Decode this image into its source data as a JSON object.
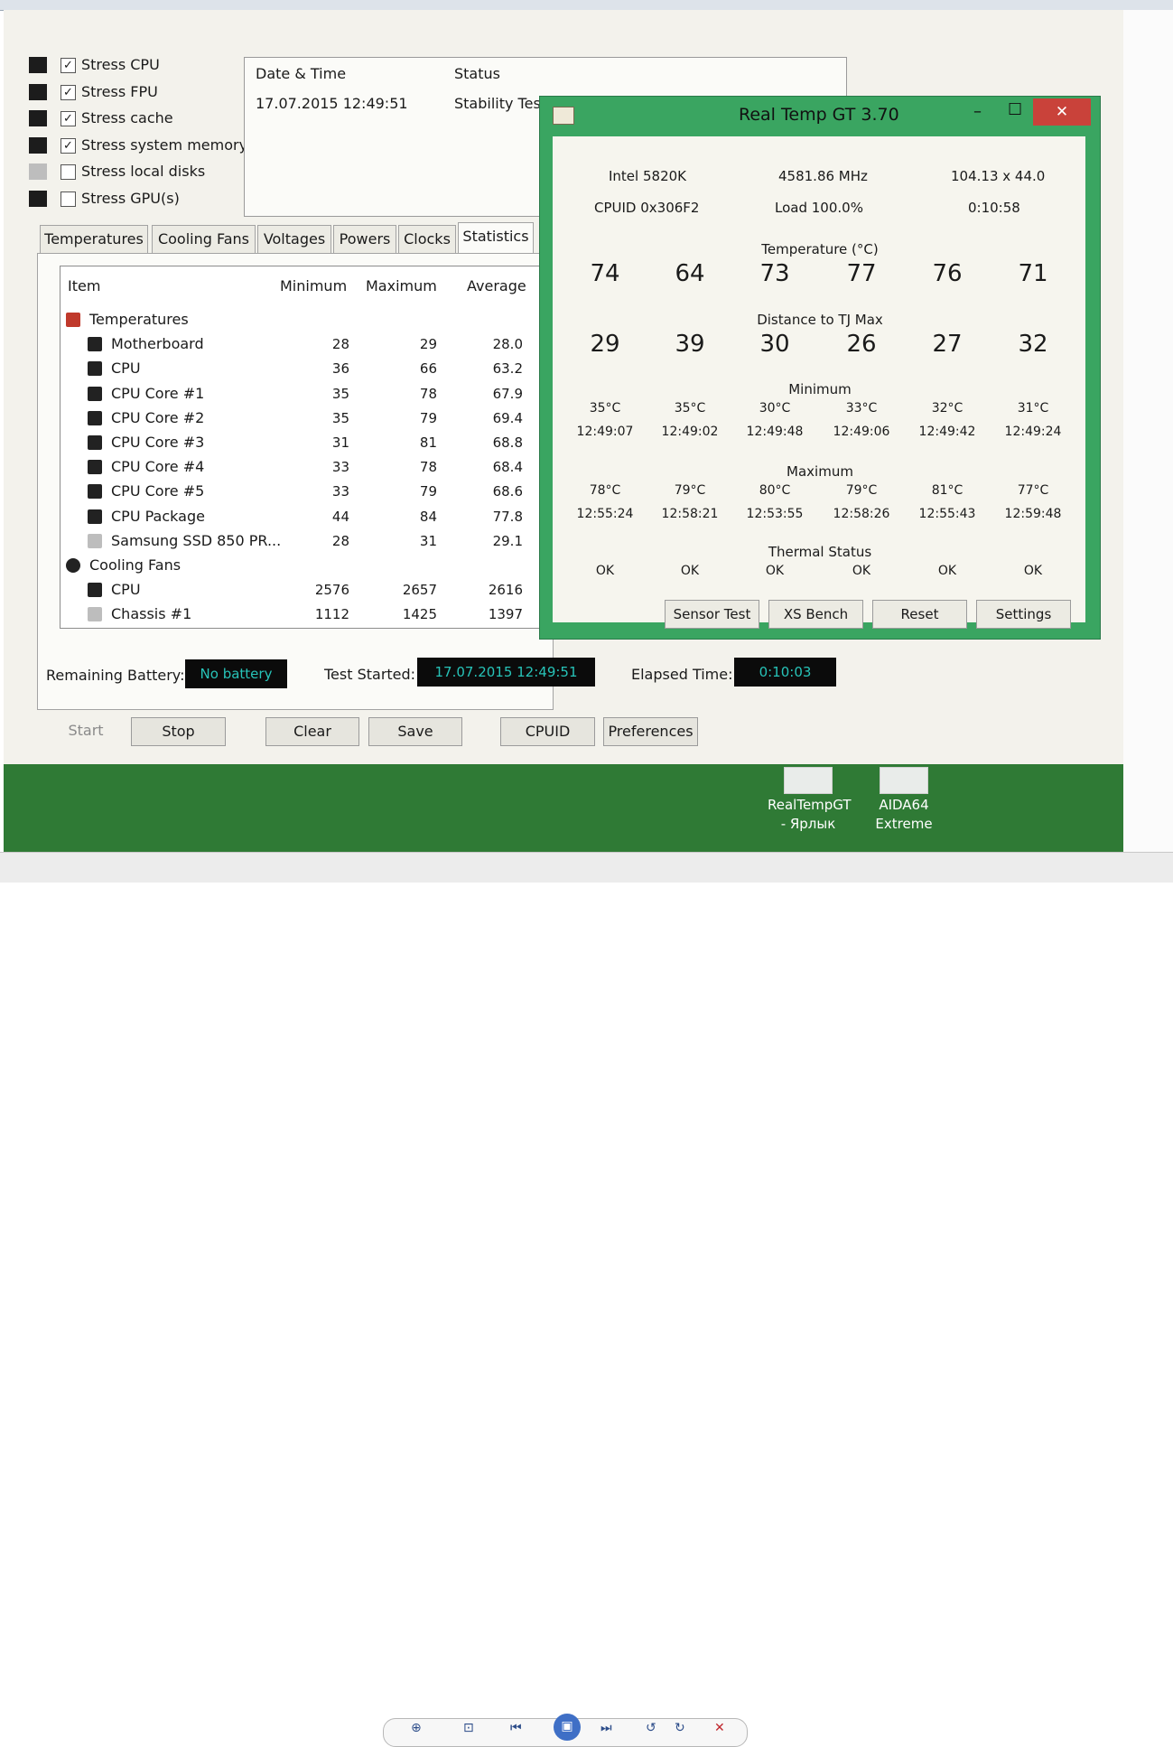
{
  "checks": [
    {
      "label": "Stress CPU",
      "checked": true,
      "icon": "cpu-icon"
    },
    {
      "label": "Stress FPU",
      "checked": true,
      "icon": "fpu-icon"
    },
    {
      "label": "Stress cache",
      "checked": true,
      "icon": "cache-icon"
    },
    {
      "label": "Stress system memory",
      "checked": true,
      "icon": "memory-icon"
    },
    {
      "label": "Stress local disks",
      "checked": false,
      "icon": "disk-icon"
    },
    {
      "label": "Stress GPU(s)",
      "checked": false,
      "icon": "gpu-icon"
    }
  ],
  "check_mark": "✓",
  "status_panel": {
    "col_date": "Date & Time",
    "col_status": "Status",
    "date_value": "17.07.2015 12:49:51",
    "status_value": "Stability Test"
  },
  "tabs": [
    "Temperatures",
    "Cooling Fans",
    "Voltages",
    "Powers",
    "Clocks",
    "Statistics"
  ],
  "active_tab": "Statistics",
  "table": {
    "headers": {
      "item": "Item",
      "min": "Minimum",
      "max": "Maximum",
      "avg": "Average"
    },
    "rows": [
      {
        "name": "Temperatures",
        "min": "",
        "max": "",
        "avg": "",
        "group": true,
        "icon": "thermometer-icon"
      },
      {
        "name": "Motherboard",
        "min": "28",
        "max": "29",
        "avg": "28.0",
        "icon": "motherboard-icon"
      },
      {
        "name": "CPU",
        "min": "36",
        "max": "66",
        "avg": "63.2",
        "icon": "cpu-chip-icon"
      },
      {
        "name": "CPU Core #1",
        "min": "35",
        "max": "78",
        "avg": "67.9",
        "icon": "cpu-chip-icon"
      },
      {
        "name": "CPU Core #2",
        "min": "35",
        "max": "79",
        "avg": "69.4",
        "icon": "cpu-chip-icon"
      },
      {
        "name": "CPU Core #3",
        "min": "31",
        "max": "81",
        "avg": "68.8",
        "icon": "cpu-chip-icon"
      },
      {
        "name": "CPU Core #4",
        "min": "33",
        "max": "78",
        "avg": "68.4",
        "icon": "cpu-chip-icon"
      },
      {
        "name": "CPU Core #5",
        "min": "33",
        "max": "79",
        "avg": "68.6",
        "icon": "cpu-chip-icon"
      },
      {
        "name": "CPU Package",
        "min": "44",
        "max": "84",
        "avg": "77.8",
        "icon": "cpu-chip-icon"
      },
      {
        "name": "Samsung SSD 850 PR...",
        "min": "28",
        "max": "31",
        "avg": "29.1",
        "icon": "ssd-icon"
      },
      {
        "name": "Cooling Fans",
        "min": "",
        "max": "",
        "avg": "",
        "group": true,
        "icon": "fan-icon"
      },
      {
        "name": "CPU",
        "min": "2576",
        "max": "2657",
        "avg": "2616",
        "icon": "cpu-chip-icon"
      },
      {
        "name": "Chassis #1",
        "min": "1112",
        "max": "1425",
        "avg": "1397",
        "icon": "chassis-icon"
      }
    ]
  },
  "footer": {
    "battery_label": "Remaining Battery:",
    "battery_value": "No battery",
    "started_label": "Test Started:",
    "started_value": "17.07.2015 12:49:51",
    "elapsed_label": "Elapsed Time:",
    "elapsed_value": "0:10:03",
    "lcd_color": "#27c3b8"
  },
  "buttons": {
    "start": "Start",
    "stop": "Stop",
    "clear": "Clear",
    "save": "Save",
    "cpuid": "CPUID",
    "preferences": "Preferences"
  },
  "desktop_icons": [
    {
      "label": "RealTempGT",
      "label2": "- Ярлык"
    },
    {
      "label": "AIDA64",
      "label2": "Extreme"
    }
  ],
  "realtemp": {
    "title": "Real Temp GT 3.70",
    "minimize": "–",
    "maximize": "☐",
    "close": "✕",
    "cpu_name": "Intel 5820K",
    "clock": "4581.86 MHz",
    "multiplier": "104.13 x 44.0",
    "cpuid": "CPUID  0x306F2",
    "load": "Load  100.0%",
    "uptime": "0:10:58",
    "temp_label": "Temperature (°C)",
    "temps": [
      "74",
      "64",
      "73",
      "77",
      "76",
      "71"
    ],
    "distance_label": "Distance to TJ Max",
    "distances": [
      "29",
      "39",
      "30",
      "26",
      "27",
      "32"
    ],
    "min_label": "Minimum",
    "min_temps": [
      "35°C",
      "35°C",
      "30°C",
      "33°C",
      "32°C",
      "31°C"
    ],
    "min_times": [
      "12:49:07",
      "12:49:02",
      "12:49:48",
      "12:49:06",
      "12:49:42",
      "12:49:24"
    ],
    "max_label": "Maximum",
    "max_temps": [
      "78°C",
      "79°C",
      "80°C",
      "79°C",
      "81°C",
      "77°C"
    ],
    "max_times": [
      "12:55:24",
      "12:58:21",
      "12:53:55",
      "12:58:26",
      "12:55:43",
      "12:59:48"
    ],
    "thermal_label": "Thermal Status",
    "thermal": [
      "OK",
      "OK",
      "OK",
      "OK",
      "OK",
      "OK"
    ],
    "buttons": [
      "Sensor Test",
      "XS Bench",
      "Reset",
      "Settings"
    ],
    "frame_color": "#3aa561",
    "close_color": "#c9423a"
  }
}
